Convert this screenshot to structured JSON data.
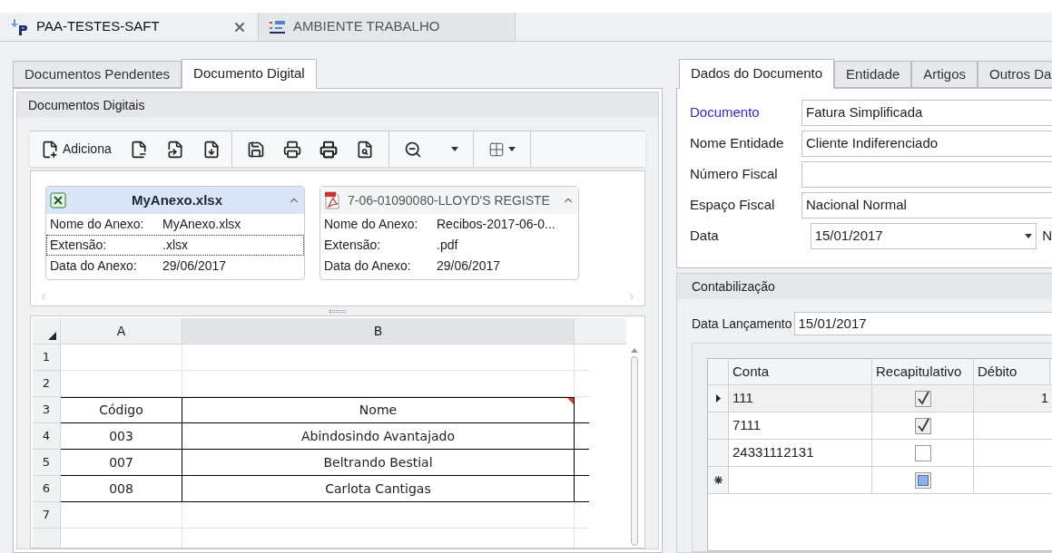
{
  "document_tabs": [
    {
      "label": "PAA-TESTES-SAFT",
      "selected": true,
      "closable": true
    },
    {
      "label": "AMBIENTE TRABALHO",
      "selected": false,
      "closable": false
    }
  ],
  "left_tabs": [
    {
      "label": "Documentos Pendentes",
      "selected": false
    },
    {
      "label": "Documento Digital",
      "selected": true
    }
  ],
  "attachments": {
    "title": "Documentos Digitais",
    "add_label": "Adiciona",
    "cards": [
      {
        "kind": "xlsx",
        "title": "MyAnexo.xlsx",
        "selected": true,
        "fields": [
          {
            "label": "Nome do Anexo:",
            "value": "MyAnexo.xlsx",
            "focused": false
          },
          {
            "label": "Extensão:",
            "value": ".xlsx",
            "focused": true
          },
          {
            "label": "Data do Anexo:",
            "value": "29/06/2017",
            "focused": false
          }
        ]
      },
      {
        "kind": "pdf",
        "title": "7-06-01090080-LLOYD'S REGISTE",
        "selected": false,
        "fields": [
          {
            "label": "Nome do Anexo:",
            "value": "Recibos-2017-06-0...",
            "focused": false
          },
          {
            "label": "Extensão:",
            "value": ".pdf",
            "focused": false
          },
          {
            "label": "Data do Anexo:",
            "value": "29/06/2017",
            "focused": false
          }
        ]
      }
    ]
  },
  "spreadsheet": {
    "columns": [
      "A",
      "B"
    ],
    "rows": [
      {
        "number": "1"
      },
      {
        "number": "2"
      },
      {
        "number": "3",
        "cells": [
          "Código",
          "Nome"
        ]
      },
      {
        "number": "4",
        "cells": [
          "003",
          "Abindosindo Avantajado"
        ]
      },
      {
        "number": "5",
        "cells": [
          "007",
          "Beltrando Bestial"
        ]
      },
      {
        "number": "6",
        "cells": [
          "008",
          "Carlota Cantigas"
        ]
      },
      {
        "number": "7"
      }
    ]
  },
  "right_tabs": [
    {
      "label": "Dados do Documento",
      "selected": true
    },
    {
      "label": "Entidade",
      "selected": false
    },
    {
      "label": "Artigos",
      "selected": false
    },
    {
      "label": "Outros Da",
      "selected": false
    }
  ],
  "document_form": {
    "fields": [
      {
        "label": "Documento",
        "value": "Fatura Simplificada",
        "required": true
      },
      {
        "label": "Nome Entidade",
        "value": "Cliente Indiferenciado",
        "required": false
      },
      {
        "label": "Número Fiscal",
        "required": false
      },
      {
        "label": "Espaço Fiscal",
        "value": "Nacional Normal",
        "required": false
      },
      {
        "label": "Data",
        "value": "15/01/2017",
        "required": false,
        "kind": "date",
        "trailing": "N"
      }
    ]
  },
  "accounting": {
    "title": "Contabilização",
    "date_label": "Data Lançamento",
    "date_value": "15/01/2017",
    "columns": [
      "Conta",
      "Recapitulativo",
      "Débito"
    ],
    "rows": [
      {
        "kind": "entry",
        "account": "111",
        "checked": true,
        "debit": "1",
        "selected": true
      },
      {
        "kind": "entry",
        "account": "7111",
        "checked": true,
        "selected": false
      },
      {
        "kind": "entry",
        "account": "24331112131",
        "checked": false,
        "selected": false
      },
      {
        "kind": "new",
        "selected": false
      }
    ]
  }
}
